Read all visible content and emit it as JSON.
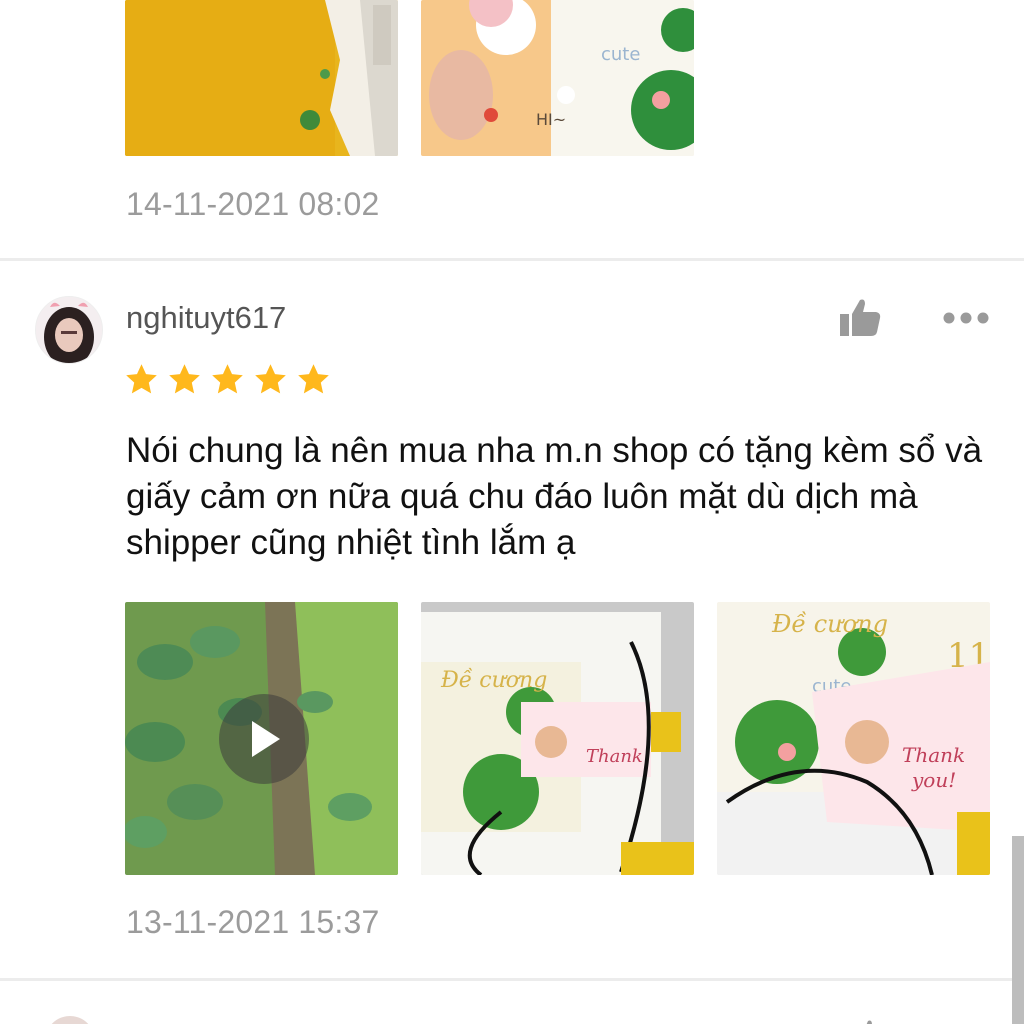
{
  "previous_review": {
    "timestamp": "14-11-2021 08:02",
    "photos": [
      {
        "icon": "photo-yellow-paper"
      },
      {
        "icon": "photo-notebook-cute"
      }
    ]
  },
  "review": {
    "username": "nghituyt617",
    "rating": 5,
    "rating_max": 5,
    "text": "Nói chung là nên mua nha m.n shop có tặng kèm sổ và giấy cảm ơn nữa quá chu đáo luôn mặt dù dịch mà shipper cũng nhiệt tình lắm ạ",
    "timestamp": "13-11-2021 15:37",
    "media": [
      {
        "type": "video",
        "icon": "play-icon"
      },
      {
        "type": "image",
        "icon": "photo-notebook-thankyou-card"
      },
      {
        "type": "image",
        "icon": "photo-notebook-thankyou-card-closeup"
      }
    ]
  },
  "colors": {
    "star": "#ffb81c",
    "text_secondary": "#9b9b9b",
    "icon_gray": "#9a9a9a",
    "divider": "#ececec"
  }
}
